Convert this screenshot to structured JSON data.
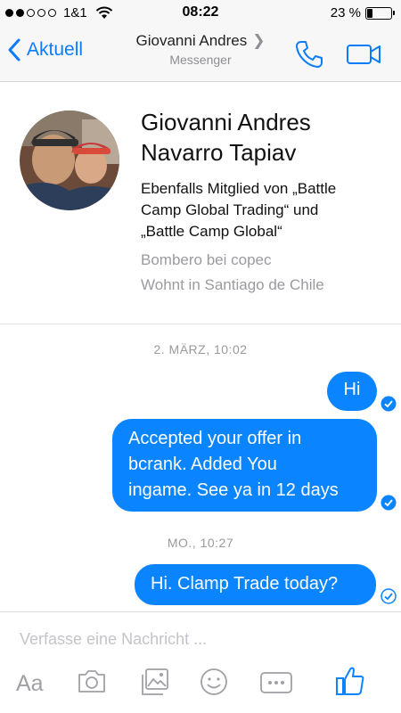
{
  "status_bar": {
    "carrier": "1&1",
    "time": "08:22",
    "battery_text": "23 %",
    "battery_level": 0.23
  },
  "nav": {
    "back_label": "Aktuell",
    "title": "Giovanni Andres",
    "subtitle": "Messenger"
  },
  "profile": {
    "name_line1": "Giovanni Andres",
    "name_line2": "Navarro Tapiav",
    "groups_line1": "Ebenfalls Mitglied von „Battle",
    "groups_line2": "Camp Global Trading“ und",
    "groups_line3": "„Battle Camp Global“",
    "work": "Bombero bei copec",
    "home": "Wohnt in Santiago de Chile"
  },
  "messages": {
    "timestamp1": "2. MÄRZ, 10:02",
    "msg1": "Hi",
    "msg2_line1": "Accepted your offer in",
    "msg2_line2": "bcrank. Added You",
    "msg2_line3": "ingame. See ya in 12 days",
    "timestamp2": "MO., 10:27",
    "msg3": "Hi. Clamp Trade today?"
  },
  "composer": {
    "placeholder": "Verfasse eine Nachricht ...",
    "text_format_label": "Aa"
  },
  "colors": {
    "accent": "#0a84ff",
    "link": "#0a7cff",
    "muted": "#9a9a9f"
  },
  "icons": [
    "back-chevron-icon",
    "phone-icon",
    "video-camera-icon",
    "wifi-icon",
    "battery-icon",
    "read-check-icon",
    "camera-icon",
    "photo-gallery-icon",
    "emoji-icon",
    "more-icon",
    "like-thumb-icon"
  ]
}
